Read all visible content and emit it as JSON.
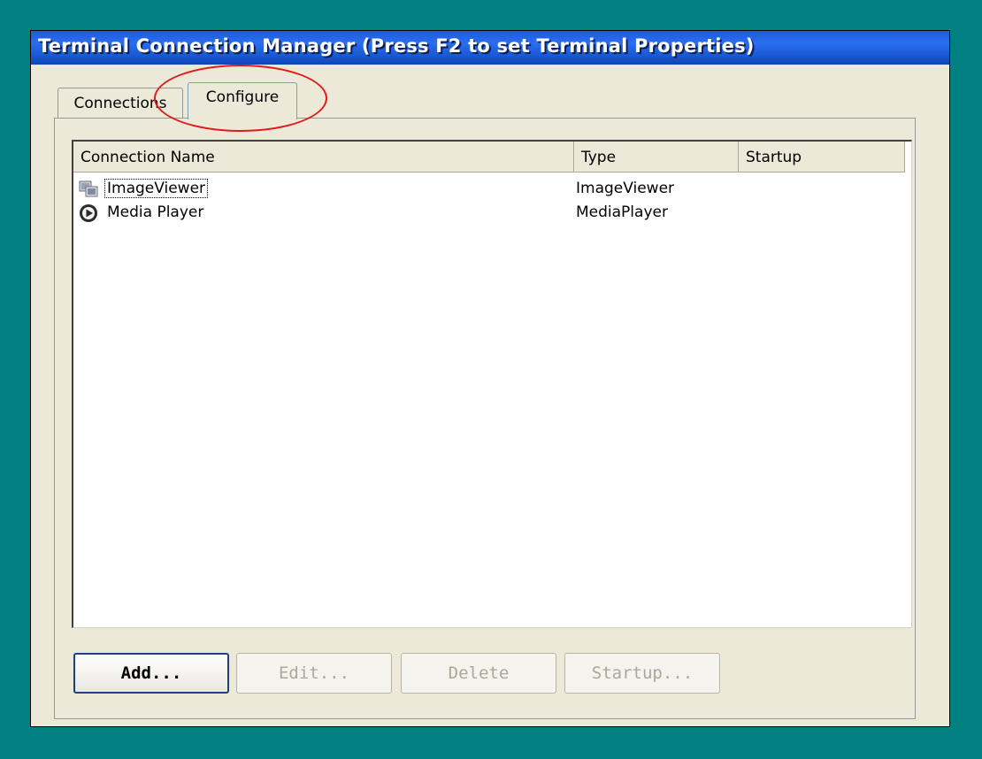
{
  "window": {
    "title": "Terminal Connection Manager (Press F2 to set Terminal Properties)"
  },
  "tabs": [
    {
      "label": "Connections",
      "selected": false
    },
    {
      "label": "Configure",
      "selected": true
    }
  ],
  "list": {
    "columns": [
      "Connection Name",
      "Type",
      "Startup"
    ],
    "rows": [
      {
        "name": "ImageViewer",
        "type": "ImageViewer",
        "startup": "",
        "icon": "image-viewer-icon",
        "focused": true
      },
      {
        "name": "Media Player",
        "type": "MediaPlayer",
        "startup": "",
        "icon": "media-player-icon",
        "focused": false
      }
    ]
  },
  "buttons": {
    "add": "Add...",
    "edit": "Edit...",
    "delete": "Delete",
    "startup": "Startup..."
  },
  "colors": {
    "desktop": "#008080",
    "titlebar": "#1d5bd8",
    "annotation": "#e21a1a"
  }
}
